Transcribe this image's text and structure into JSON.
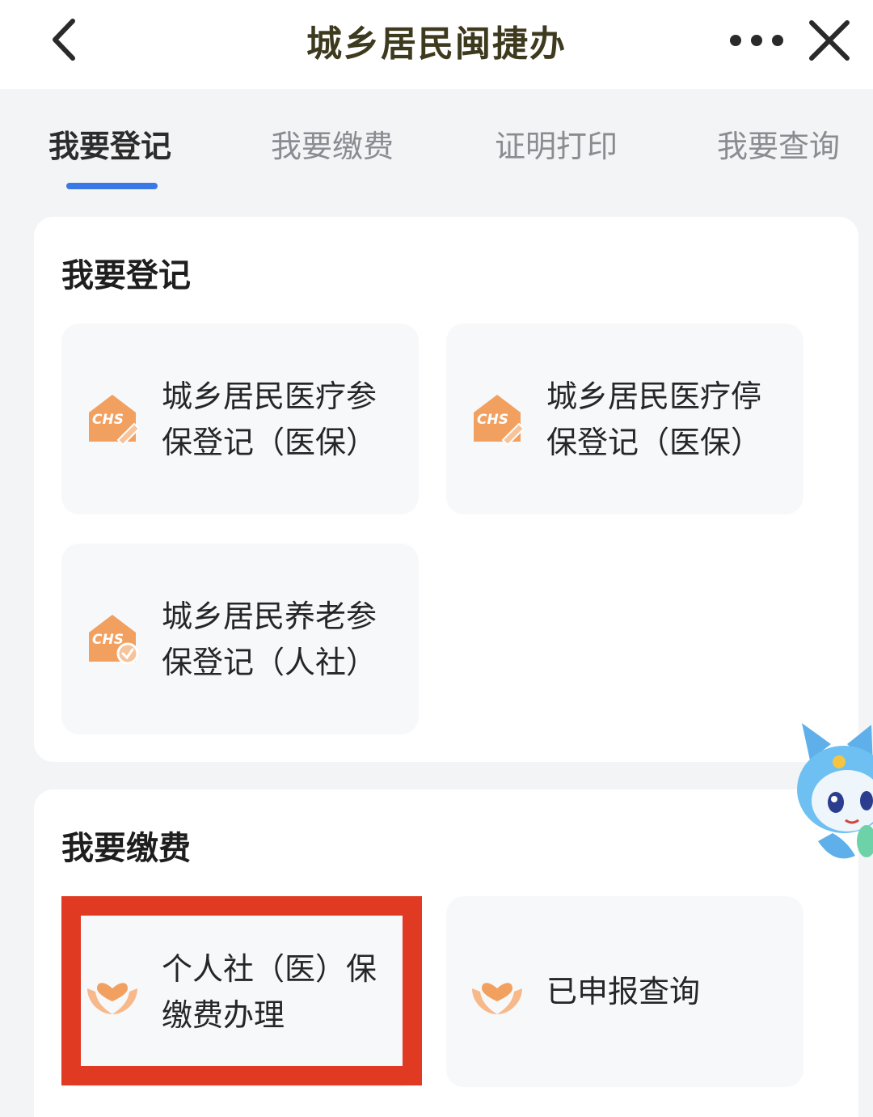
{
  "nav": {
    "title": "城乡居民闽捷办",
    "back_icon": "chevron-left-icon",
    "more_icon": "more-dots-icon",
    "close_icon": "close-icon"
  },
  "tabs": [
    {
      "label": "我要登记",
      "active": true
    },
    {
      "label": "我要缴费",
      "active": false
    },
    {
      "label": "证明打印",
      "active": false
    },
    {
      "label": "我要查询",
      "active": false
    }
  ],
  "sections": [
    {
      "title": "我要登记",
      "items": [
        {
          "line1": "城乡居民医疗参",
          "line2": "保登记（医保）",
          "icon": "chs-edit-icon"
        },
        {
          "line1": "城乡居民医疗停",
          "line2": "保登记（医保）",
          "icon": "chs-edit-icon"
        },
        {
          "line1": "城乡居民养老参",
          "line2": "保登记（人社）",
          "icon": "chs-check-icon"
        }
      ]
    },
    {
      "title": "我要缴费",
      "items": [
        {
          "line1": "个人社（医）保",
          "line2": "缴费办理",
          "icon": "hands-heart-icon",
          "highlighted": true
        },
        {
          "line1": "已申报查询",
          "line2": "",
          "icon": "hands-heart-icon"
        }
      ]
    }
  ],
  "icon_text": "CHS",
  "colors": {
    "accent": "#3a78e6",
    "icon_orange": "#f2a060",
    "highlight": "#e03a22",
    "title": "#3d3a1e"
  }
}
